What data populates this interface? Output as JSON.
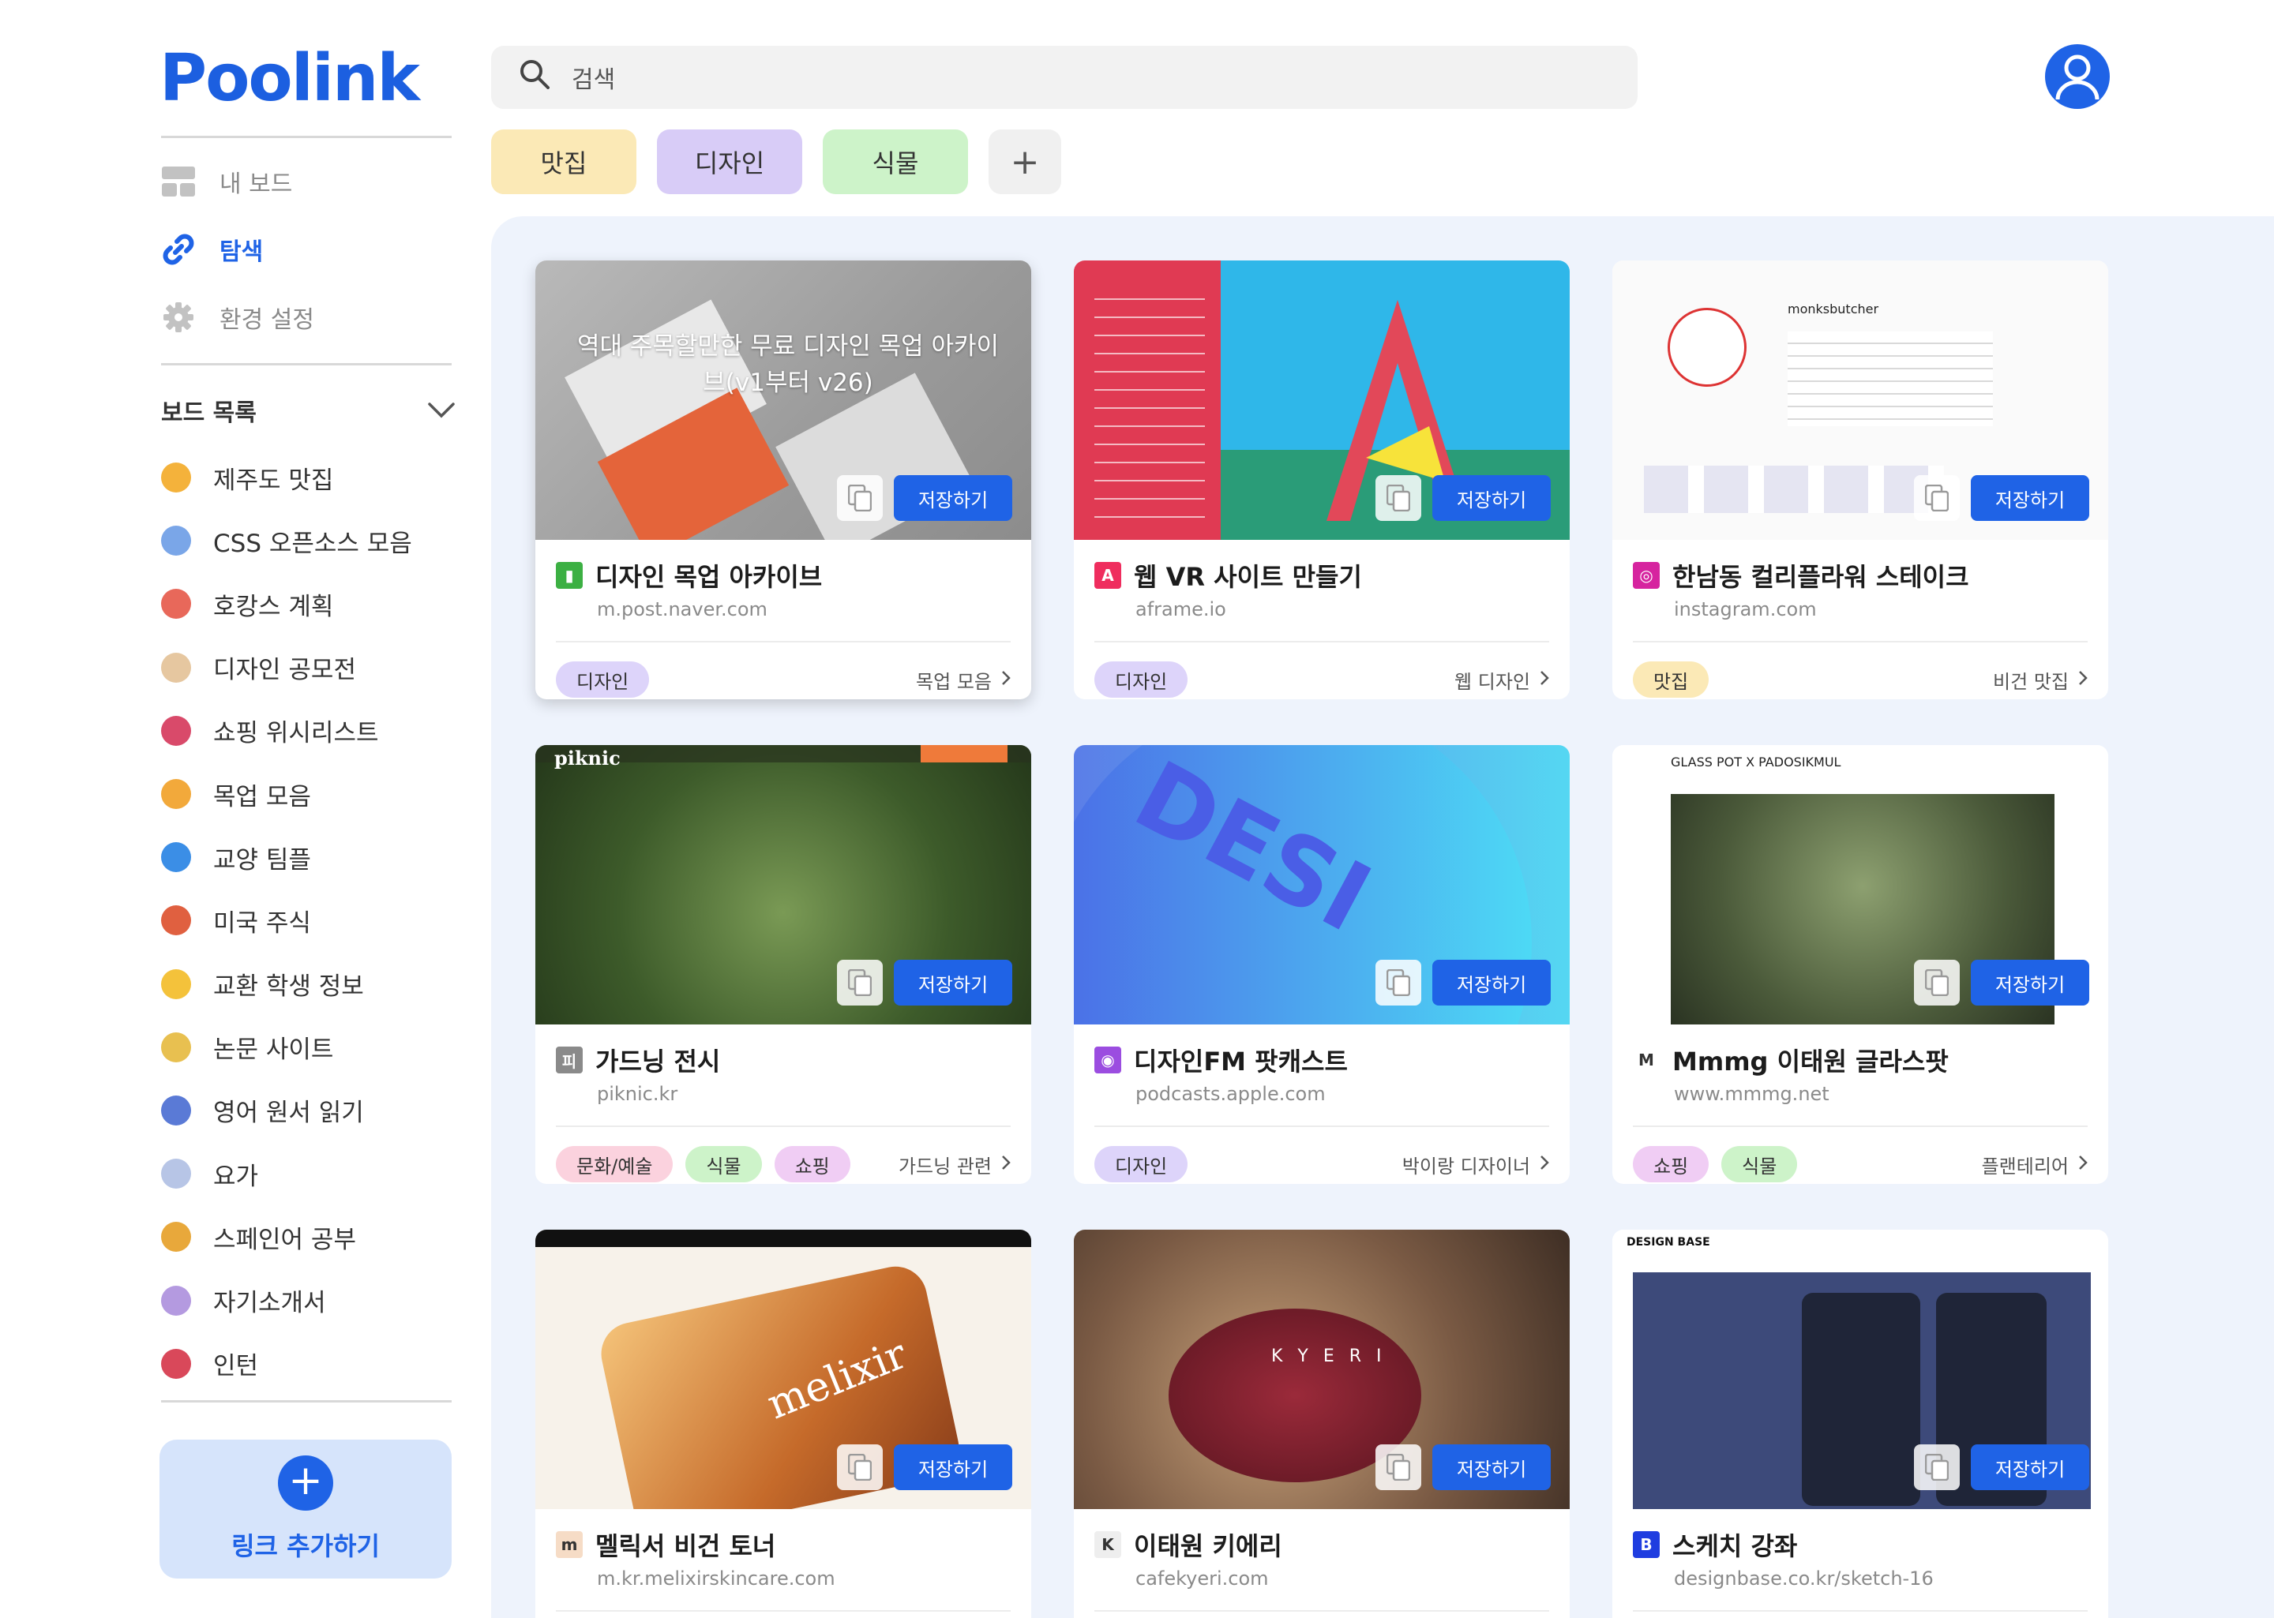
{
  "app": {
    "logo": "Poolink"
  },
  "nav": {
    "my_board": "내 보드",
    "explore": "탐색",
    "settings": "환경 설정"
  },
  "boards": {
    "header": "보드 목록",
    "items": [
      {
        "label": "제주도 맛집",
        "color": "#f4b23b"
      },
      {
        "label": "CSS 오픈소스 모음",
        "color": "#7aa6e8"
      },
      {
        "label": "호캉스 계획",
        "color": "#e8685a"
      },
      {
        "label": "디자인 공모전",
        "color": "#e6c7a0"
      },
      {
        "label": "쇼핑 위시리스트",
        "color": "#d94a6a"
      },
      {
        "label": "목업 모음",
        "color": "#f2a93b"
      },
      {
        "label": "교양 팀플",
        "color": "#3b8ee6"
      },
      {
        "label": "미국 주식",
        "color": "#e06040"
      },
      {
        "label": "교환 학생 정보",
        "color": "#f4c23b"
      },
      {
        "label": "논문 사이트",
        "color": "#e8c050"
      },
      {
        "label": "영어 원서 읽기",
        "color": "#5a7ad6"
      },
      {
        "label": "요가",
        "color": "#b7c5e6"
      },
      {
        "label": "스페인어 공부",
        "color": "#e8a83b"
      },
      {
        "label": "자기소개서",
        "color": "#b49ae0"
      },
      {
        "label": "인턴",
        "color": "#d9485a"
      }
    ]
  },
  "add_link": {
    "label": "링크 추가하기"
  },
  "search": {
    "placeholder": "검색"
  },
  "chips": [
    {
      "label": "맛집",
      "color": "#fbe9b6"
    },
    {
      "label": "디자인",
      "color": "#d8ccf7"
    },
    {
      "label": "식물",
      "color": "#cdf3c9"
    },
    {
      "label": "+",
      "color": "#f0f0f0"
    }
  ],
  "save_label": "저장하기",
  "cards": [
    {
      "title": "디자인 목업 아카이브",
      "url": "m.post.naver.com",
      "favicon": "naver-post-icon",
      "favicon_color": "#3cb043",
      "thumb_caption": "역대 주목할만한 무료 디자인 목업 아카이브(v1부터 v26)",
      "tags": [
        {
          "label": "디자인",
          "color": "#ddd4fa"
        }
      ],
      "board": "목업 모음"
    },
    {
      "title": "웹 VR 사이트 만들기",
      "url": "aframe.io",
      "favicon": "aframe-icon",
      "favicon_color": "#ef2d5e",
      "tags": [
        {
          "label": "디자인",
          "color": "#ddd4fa"
        }
      ],
      "board": "웹 디자인"
    },
    {
      "title": "한남동 컬리플라워 스테이크",
      "url": "instagram.com",
      "favicon": "instagram-icon",
      "favicon_color": "#d6249f",
      "thumb_caption": "monksbutcher",
      "tags": [
        {
          "label": "맛집",
          "color": "#fbe9b6"
        }
      ],
      "board": "비건 맛집"
    },
    {
      "title": "가드닝 전시",
      "url": "piknic.kr",
      "favicon": "piknic-icon",
      "favicon_color": "#8a8a8a",
      "thumb_caption": "piknic",
      "tags": [
        {
          "label": "문화/예술",
          "color": "#fbd2de"
        },
        {
          "label": "식물",
          "color": "#cdf3c9"
        },
        {
          "label": "쇼핑",
          "color": "#f0cdf4"
        }
      ],
      "board": "가드닝 관련"
    },
    {
      "title": "디자인FM 팟캐스트",
      "url": "podcasts.apple.com",
      "favicon": "podcasts-icon",
      "favicon_color": "#9b4de0",
      "tags": [
        {
          "label": "디자인",
          "color": "#ddd4fa"
        }
      ],
      "board": "박이랑 디자이너"
    },
    {
      "title": "Mmmg 이태원 글라스팟",
      "url": "www.mmmg.net",
      "favicon": "mmmg-icon",
      "favicon_color": "#ffffff",
      "thumb_caption": "GLASS POT X PADOSIKMUL",
      "tags": [
        {
          "label": "쇼핑",
          "color": "#f0cdf4"
        },
        {
          "label": "식물",
          "color": "#cdf3c9"
        }
      ],
      "board": "플랜테리어"
    },
    {
      "title": "멜릭서 비건 토너",
      "url": "m.kr.melixirskincare.com",
      "favicon": "melixir-icon",
      "favicon_color": "#f6dcc6",
      "thumb_caption": "melixir",
      "tags": [],
      "board": ""
    },
    {
      "title": "이태원 키에리",
      "url": "cafekyeri.com",
      "favicon": "kyeri-icon",
      "favicon_color": "#eeeeee",
      "thumb_caption": "K Y E R I",
      "tags": [],
      "board": ""
    },
    {
      "title": "스케치 강좌",
      "url": "designbase.co.kr/sketch-16",
      "favicon": "designbase-icon",
      "favicon_color": "#1f3de0",
      "thumb_caption": "DESIGN BASE",
      "tags": [],
      "board": ""
    }
  ]
}
